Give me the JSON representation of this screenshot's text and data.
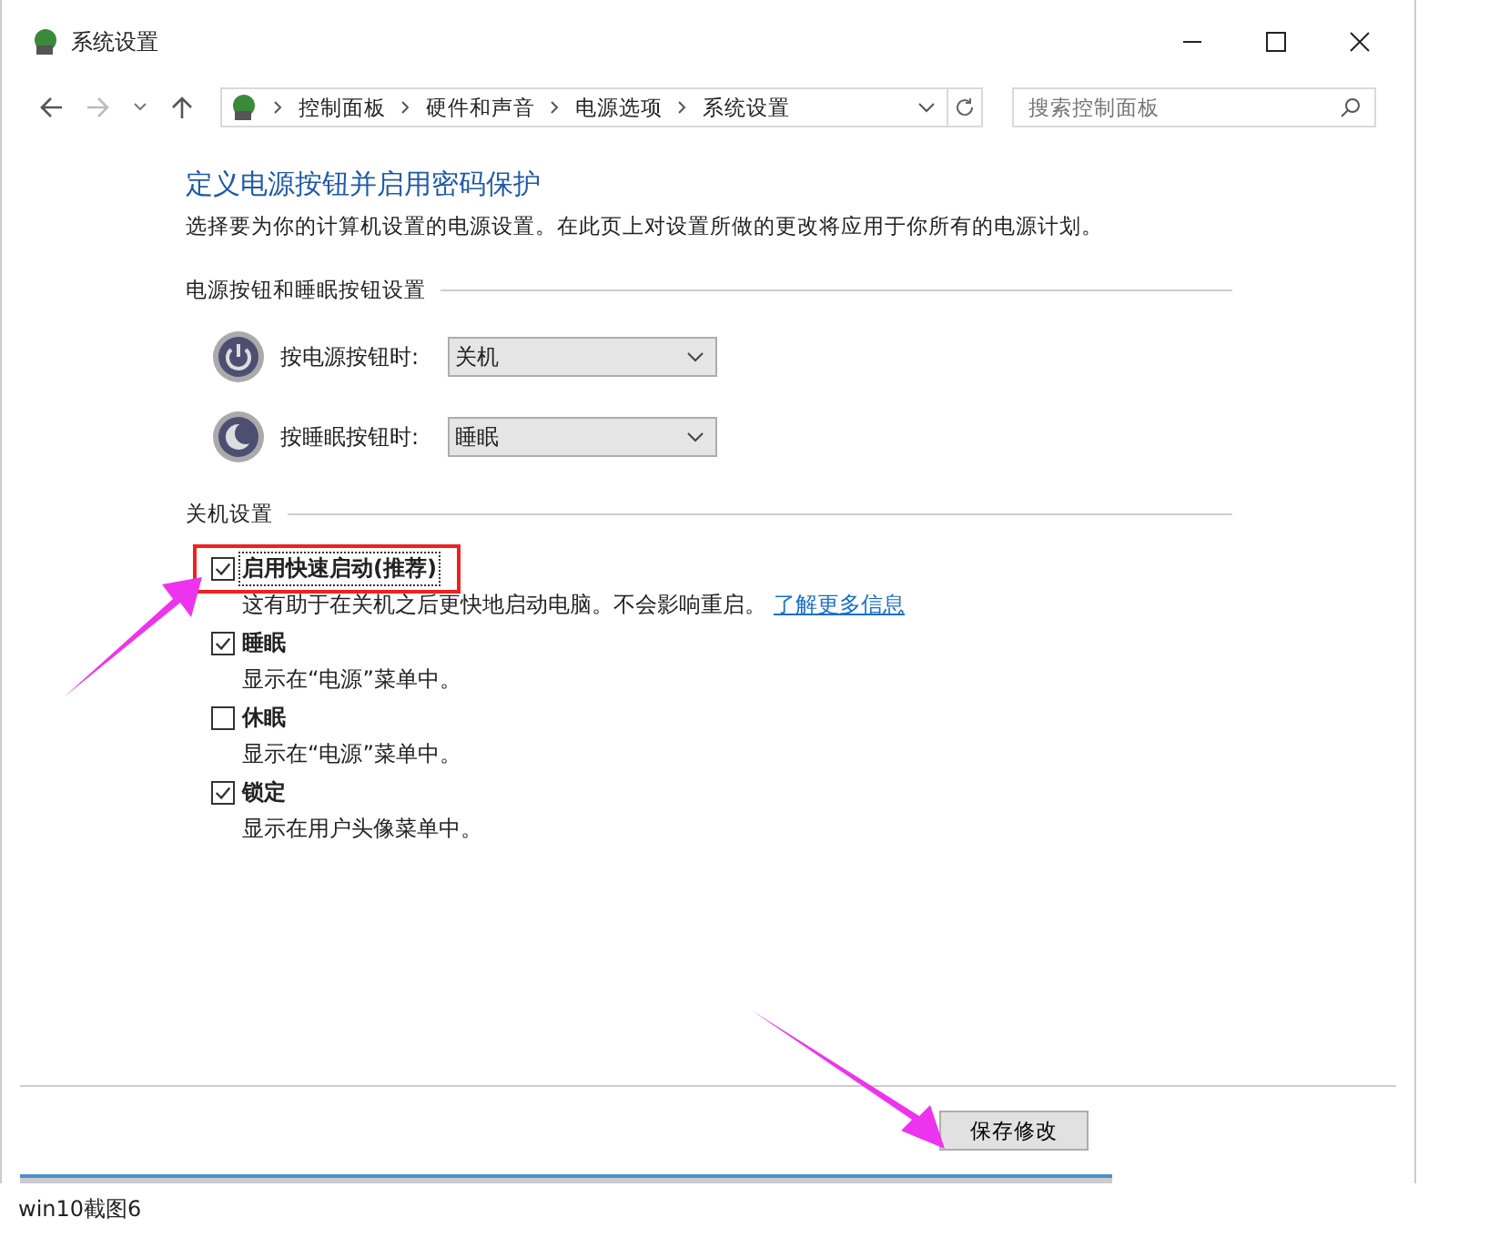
{
  "window": {
    "title": "系统设置"
  },
  "breadcrumb": [
    "控制面板",
    "硬件和声音",
    "电源选项",
    "系统设置"
  ],
  "search": {
    "placeholder": "搜索控制面板"
  },
  "heading": "定义电源按钮并启用密码保护",
  "intro": "选择要为你的计算机设置的电源设置。在此页上对设置所做的更改将应用于你所有的电源计划。",
  "button_section": {
    "title": "电源按钮和睡眠按钮设置",
    "rows": [
      {
        "kind": "power",
        "label": "按电源按钮时:",
        "value": "关机"
      },
      {
        "kind": "sleep",
        "label": "按睡眠按钮时:",
        "value": "睡眠"
      }
    ]
  },
  "shutdown_section": {
    "title": "关机设置",
    "options": [
      {
        "label": "启用快速启动(推荐)",
        "checked": true,
        "description": "这有助于在关机之后更快地启动电脑。不会影响重启。",
        "link": "了解更多信息"
      },
      {
        "label": "睡眠",
        "checked": true,
        "description": "显示在“电源”菜单中。"
      },
      {
        "label": "休眠",
        "checked": false,
        "description": "显示在“电源”菜单中。"
      },
      {
        "label": "锁定",
        "checked": true,
        "description": "显示在用户头像菜单中。"
      }
    ]
  },
  "save_button": "保存修改",
  "caption": "win10截图6"
}
